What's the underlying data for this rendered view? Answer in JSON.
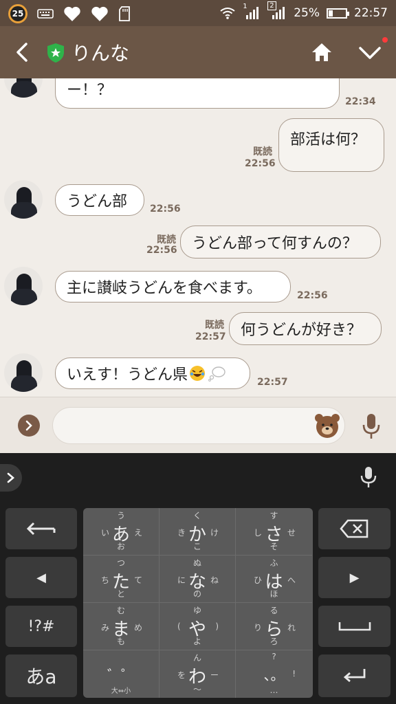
{
  "status_bar": {
    "badge": "25",
    "sim1": "1",
    "sim2": "2",
    "battery_percent": "25%",
    "battery_level": 0.25,
    "time": "22:57"
  },
  "header": {
    "title": "りんな"
  },
  "messages": [
    {
      "side": "in",
      "text": "ー！？",
      "time": "22:34"
    },
    {
      "side": "out",
      "text": "部活は何？",
      "read": "既読",
      "time": "22:56"
    },
    {
      "side": "in",
      "text": "うどん部",
      "time": "22:56"
    },
    {
      "side": "out",
      "text": "うどん部って何すんの？",
      "read": "既読",
      "time": "22:56"
    },
    {
      "side": "in",
      "text": "主に讃岐うどんを食べます。",
      "time": "22:56"
    },
    {
      "side": "out",
      "text": "何うどんが好き？",
      "read": "既読",
      "time": "22:57"
    },
    {
      "side": "in",
      "text": "いえす！うどん県",
      "time": "22:57"
    }
  ],
  "input": {
    "placeholder": ""
  },
  "keyboard": {
    "side_keys": {
      "back_arrow": "←",
      "left": "◀",
      "symbols": "!?#",
      "mode": "あa",
      "right": "▶",
      "space": "␣",
      "enter": "↵"
    },
    "flick_keys": [
      {
        "c": "あ",
        "u": "う",
        "l": "い",
        "r": "え",
        "d": "お"
      },
      {
        "c": "か",
        "u": "く",
        "l": "き",
        "r": "け",
        "d": "こ"
      },
      {
        "c": "さ",
        "u": "す",
        "l": "し",
        "r": "せ",
        "d": "そ"
      },
      {
        "c": "た",
        "u": "つ",
        "l": "ち",
        "r": "て",
        "d": "と"
      },
      {
        "c": "な",
        "u": "ぬ",
        "l": "に",
        "r": "ね",
        "d": "の"
      },
      {
        "c": "は",
        "u": "ふ",
        "l": "ひ",
        "r": "へ",
        "d": "ほ"
      },
      {
        "c": "ま",
        "u": "む",
        "l": "み",
        "r": "め",
        "d": "も"
      },
      {
        "c": "や",
        "u": "ゆ",
        "l": "(",
        "r": ")",
        "d": "よ"
      },
      {
        "c": "ら",
        "u": "る",
        "l": "り",
        "r": "れ",
        "d": "ろ"
      },
      {
        "c": "゛゜",
        "u": "",
        "l": "",
        "r": "",
        "d": "大⇔小"
      },
      {
        "c": "わ",
        "u": "ん",
        "l": "を",
        "r": "ー",
        "d": "〜"
      },
      {
        "c": "、。",
        "u": "?",
        "l": "",
        "r": "!",
        "d": "…"
      }
    ]
  }
}
